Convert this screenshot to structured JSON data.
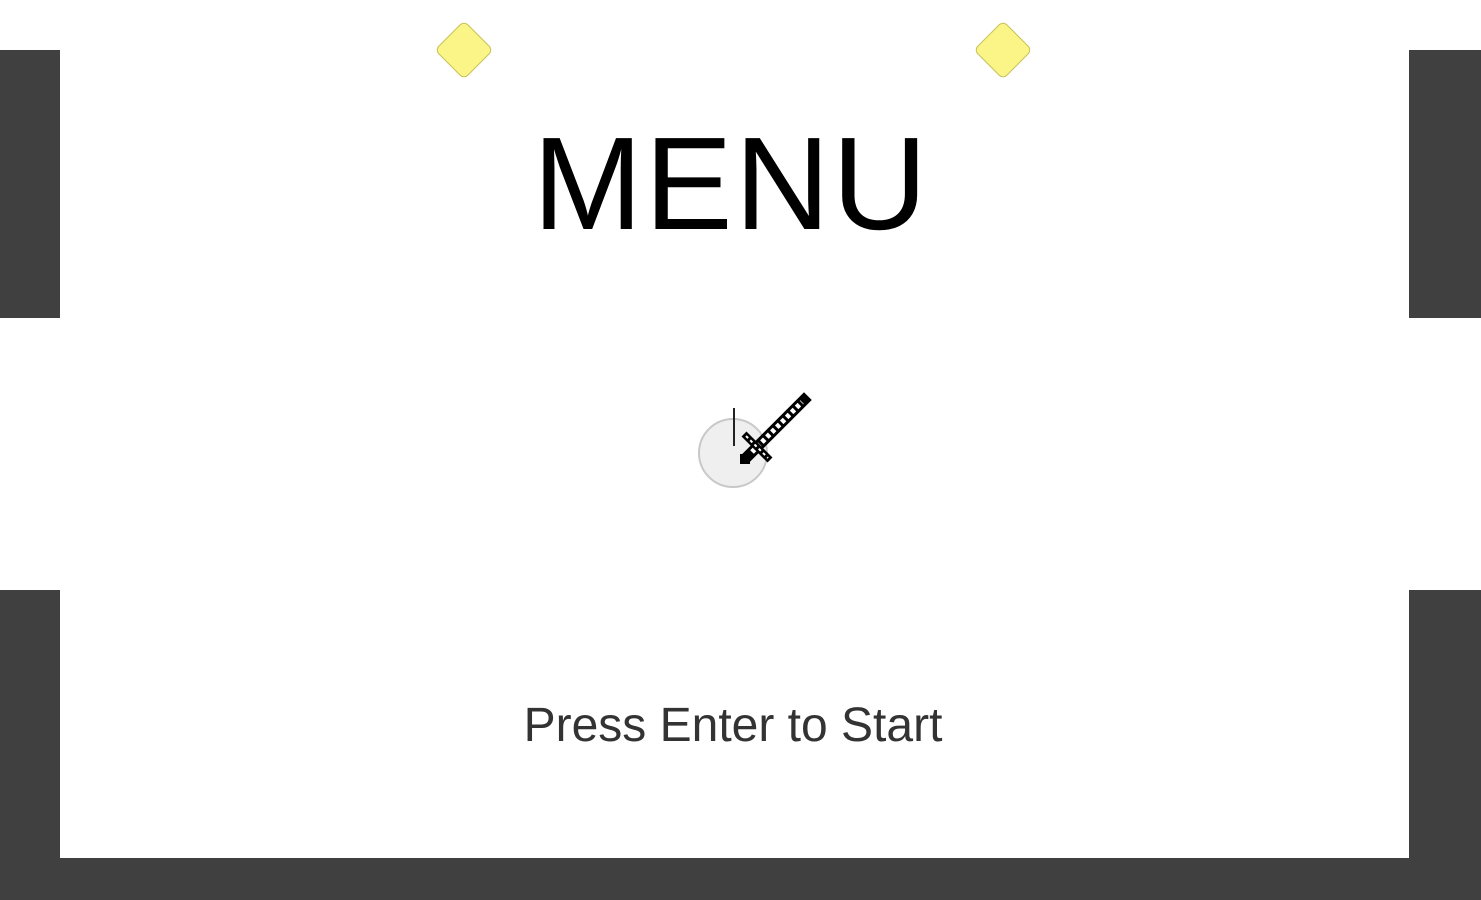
{
  "menu": {
    "title": "MENU",
    "prompt": "Press Enter to Start"
  },
  "icons": {
    "gem": "diamond-gem-icon",
    "weapon": "sword-cursor-icon"
  },
  "colors": {
    "wall": "#404040",
    "gem": "#fbf486",
    "background": "#ffffff",
    "player": "#efefef"
  }
}
